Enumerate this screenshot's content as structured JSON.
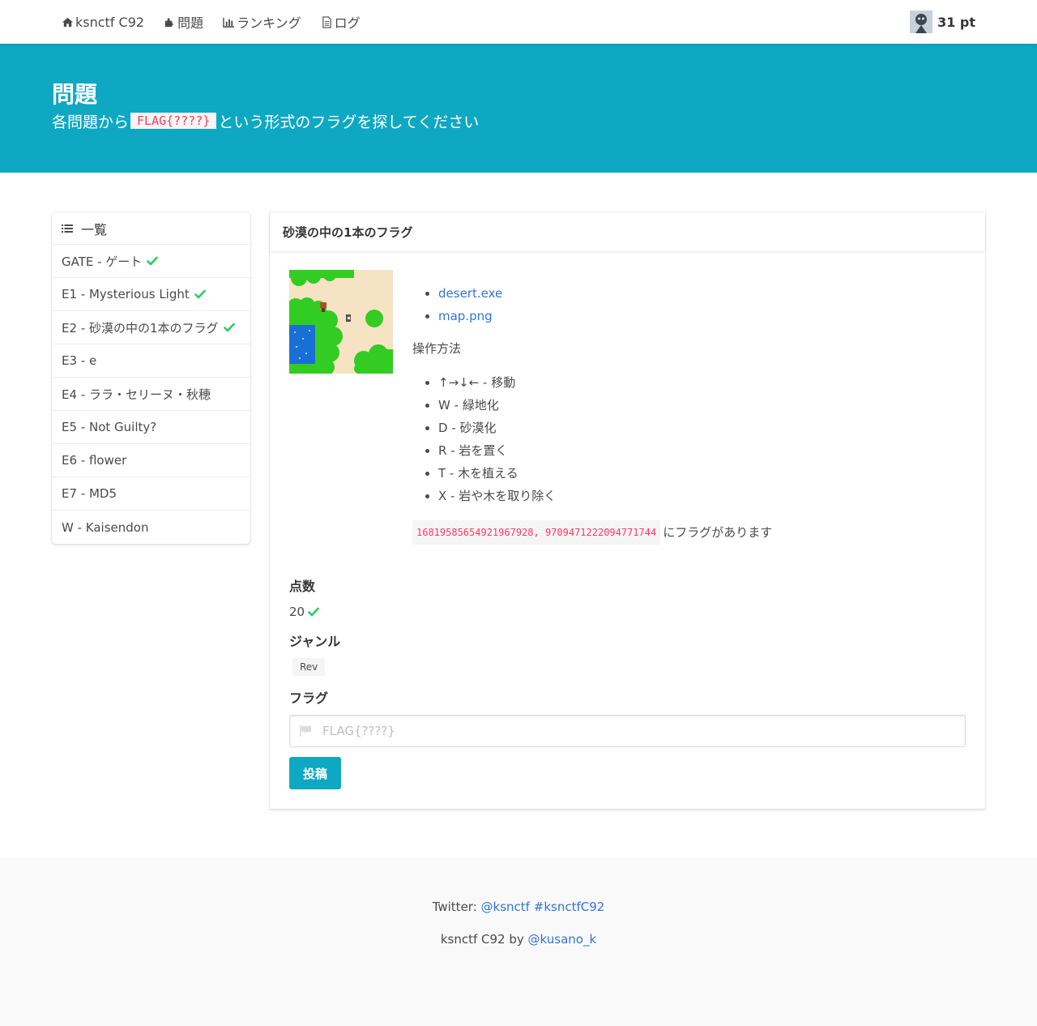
{
  "nav": {
    "home_label": "ksnctf C92",
    "problems_label": "問題",
    "ranking_label": "ランキング",
    "log_label": "ログ",
    "points": "31 pt"
  },
  "hero": {
    "title": "問題",
    "subtitle_before": "各問題から",
    "subtitle_code": "FLAG{????}",
    "subtitle_after": "という形式のフラグを探してください"
  },
  "menu": {
    "heading": "一覧",
    "items": [
      {
        "label": "GATE - ゲート",
        "solved": true
      },
      {
        "label": "E1 - Mysterious Light",
        "solved": true
      },
      {
        "label": "E2 - 砂漠の中の1本のフラグ",
        "solved": true
      },
      {
        "label": "E3 - e",
        "solved": false
      },
      {
        "label": "E4 - ララ・セリーヌ・秋穂",
        "solved": false
      },
      {
        "label": "E5 - Not Guilty?",
        "solved": false
      },
      {
        "label": "E6 - flower",
        "solved": false
      },
      {
        "label": "E7 - MD5",
        "solved": false
      },
      {
        "label": "W - Kaisendon",
        "solved": false
      }
    ]
  },
  "problem": {
    "title": "砂漠の中の1本のフラグ",
    "files": [
      "desert.exe",
      "map.png"
    ],
    "ops_heading": "操作方法",
    "ops": [
      "↑→↓← - 移動",
      "W - 緑地化",
      "D - 砂漠化",
      "R - 岩を置く",
      "T - 木を植える",
      "X - 岩や木を取り除く"
    ],
    "coords": "16819585654921967928, 9709471222094771744",
    "coords_suffix": "にフラグがあります",
    "score_label": "点数",
    "score": "20",
    "genre_label": "ジャンル",
    "genre": "Rev",
    "flag_label": "フラグ",
    "flag_placeholder": "FLAG{????}",
    "submit_label": "投稿"
  },
  "footer": {
    "twitter_prefix": "Twitter:",
    "twitter_account": "@ksnctf",
    "twitter_hashtag": "#ksnctfC92",
    "credit_prefix": "ksnctf C92 by",
    "credit_author": "@kusano_k"
  },
  "colors": {
    "primary": "#0fa8c3",
    "link": "#3273dc",
    "success": "#23d160",
    "code": "#ff3860"
  }
}
